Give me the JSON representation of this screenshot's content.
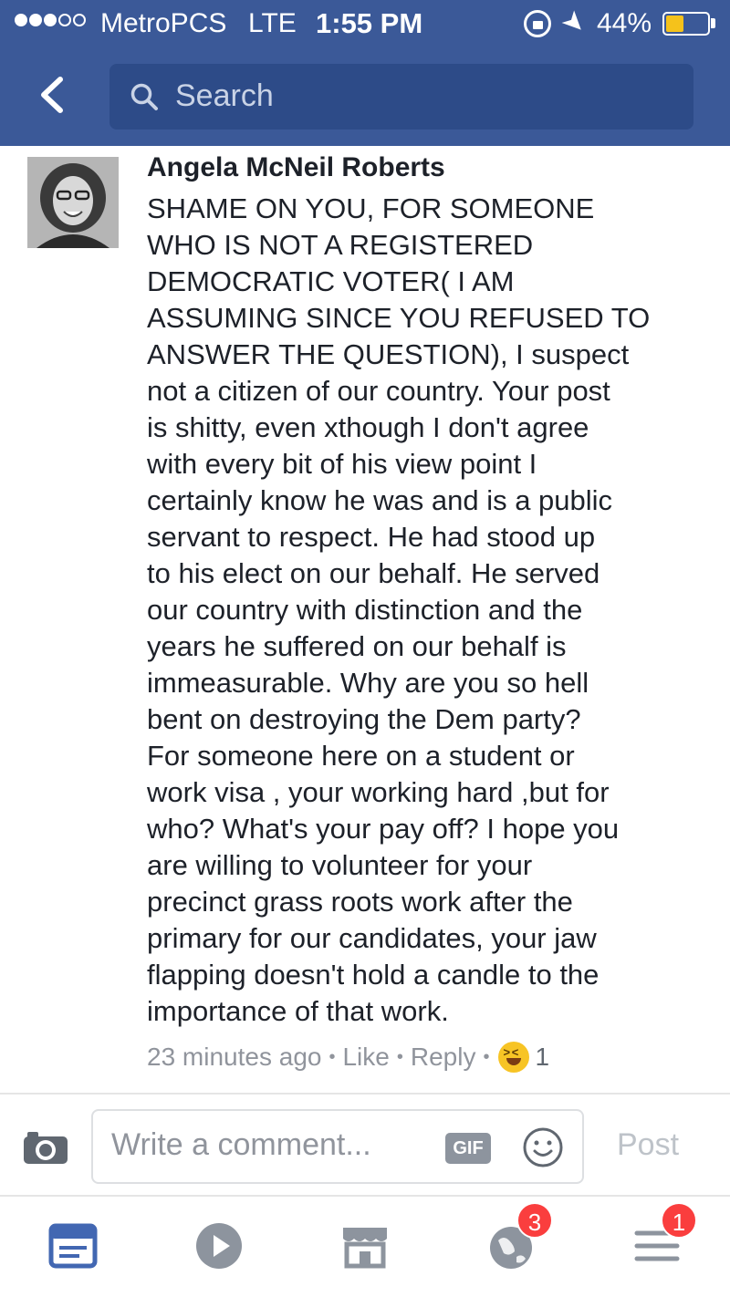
{
  "status_bar": {
    "carrier": "MetroPCS",
    "network": "LTE",
    "time": "1:55 PM",
    "battery_percent": "44%",
    "battery_level": 0.44,
    "signal_bars_filled": 3,
    "signal_bars_total": 5
  },
  "header": {
    "search_placeholder": "Search",
    "background_color": "#3b5998"
  },
  "comment": {
    "author": "Angela McNeil Roberts",
    "text": "SHAME ON YOU, FOR SOMEONE\nWHO IS NOT A REGISTERED\nDEMOCRATIC VOTER( I AM\nASSUMING SINCE YOU REFUSED TO\nANSWER THE QUESTION), I suspect\nnot a citizen of our country. Your post\nis shitty, even xthough I don't agree\nwith every bit of his view point I\ncertainly know he was and is a public\nservant to respect. He had stood up\nto his elect on our behalf. He served\nour country with distinction and the\nyears he suffered on our behalf is\nimmeasurable. Why are you so hell\nbent on destroying the Dem party?\nFor someone here on a student or\nwork visa , your working hard ,but for\nwho? What's your pay off? I hope you\nare willing to volunteer for your\nprecinct grass roots work after the\nprimary for our candidates, your jaw\nflapping doesn't hold a candle to the\nimportance of that work.",
    "timestamp": "23 minutes ago",
    "like_label": "Like",
    "reply_label": "Reply",
    "reaction_icon": "laughing-emoji-icon",
    "reaction_count": "1"
  },
  "composer": {
    "placeholder": "Write a comment...",
    "gif_label": "GIF",
    "post_label": "Post"
  },
  "bottom_nav": {
    "tabs": [
      {
        "icon": "news-feed-icon",
        "active": true,
        "badge": ""
      },
      {
        "icon": "video-play-icon",
        "active": false,
        "badge": ""
      },
      {
        "icon": "marketplace-icon",
        "active": false,
        "badge": ""
      },
      {
        "icon": "notifications-globe-icon",
        "active": false,
        "badge": "3"
      },
      {
        "icon": "menu-icon",
        "active": false,
        "badge": "1"
      }
    ],
    "active_color": "#4267b2",
    "inactive_color": "#8d949e",
    "badge_color": "#fa3e3e"
  }
}
